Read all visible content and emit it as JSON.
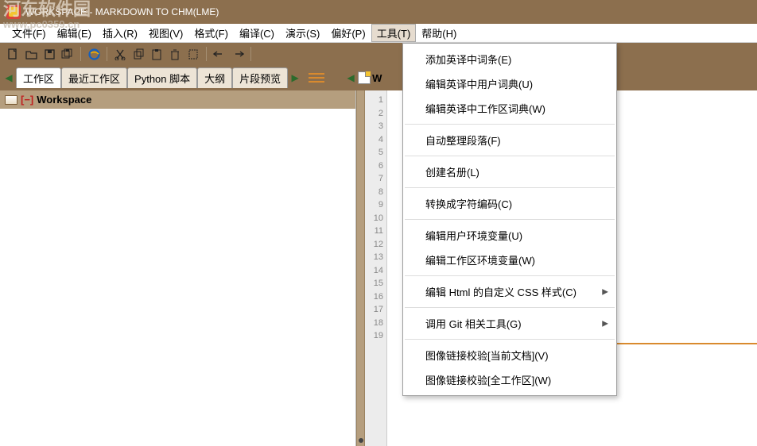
{
  "title": "WORKSPACE - MARKDOWN TO CHM(LME)",
  "watermark": {
    "line1": "河东软件园",
    "line2": "www.pc0359.cn"
  },
  "menubar": [
    {
      "label": "文件(F)"
    },
    {
      "label": "编辑(E)"
    },
    {
      "label": "插入(R)"
    },
    {
      "label": "视图(V)"
    },
    {
      "label": "格式(F)"
    },
    {
      "label": "编译(C)"
    },
    {
      "label": "演示(S)"
    },
    {
      "label": "偏好(P)"
    },
    {
      "label": "工具(T)",
      "active": true
    },
    {
      "label": "帮助(H)"
    }
  ],
  "toolbar_groups": [
    [
      "new-doc",
      "open-folder",
      "save",
      "save-all"
    ],
    [
      "internet-explorer"
    ],
    [
      "cut",
      "copy",
      "paste",
      "delete",
      "select-all"
    ],
    [
      "undo",
      "redo"
    ]
  ],
  "left_tabs": [
    {
      "label": "工作区"
    },
    {
      "label": "最近工作区"
    },
    {
      "label": "Python 脚本"
    },
    {
      "label": "大纲"
    },
    {
      "label": "片段预览"
    }
  ],
  "tree_root": "Workspace",
  "right_filename": "W",
  "line_count": 19,
  "dropdown": [
    {
      "label": "添加英译中词条(E)"
    },
    {
      "label": "编辑英译中用户词典(U)"
    },
    {
      "label": "编辑英译中工作区词典(W)"
    },
    {
      "sep": true
    },
    {
      "label": "自动整理段落(F)"
    },
    {
      "sep": true
    },
    {
      "label": "创建名册(L)"
    },
    {
      "sep": true
    },
    {
      "label": "转换成字符编码(C)"
    },
    {
      "sep": true
    },
    {
      "label": "编辑用户环境变量(U)"
    },
    {
      "label": "编辑工作区环境变量(W)"
    },
    {
      "sep": true
    },
    {
      "label": "编辑 Html 的自定义 CSS 样式(C)",
      "sub": true
    },
    {
      "sep": true
    },
    {
      "label": "调用 Git 相关工具(G)",
      "sub": true
    },
    {
      "sep": true
    },
    {
      "label": "图像链接校验[当前文档](V)"
    },
    {
      "label": "图像链接校验[全工作区](W)"
    }
  ]
}
